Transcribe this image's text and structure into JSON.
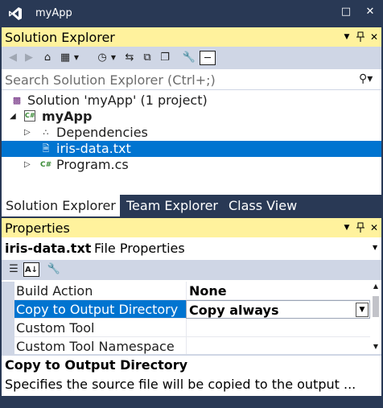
{
  "window": {
    "title": "myApp"
  },
  "colors": {
    "frame": "#293955",
    "active_header": "#fff29d",
    "toolbar": "#cfd6e5",
    "selection": "#0074d0"
  },
  "solution_explorer": {
    "header": "Solution Explorer",
    "search_placeholder": "Search Solution Explorer (Ctrl+;)",
    "tree": [
      {
        "label": "Solution 'myApp' (1 project)",
        "icon": "solution-icon",
        "expanded": null,
        "selected": false,
        "bold": false
      },
      {
        "label": "myApp",
        "icon": "csharp-project-icon",
        "expanded": true,
        "selected": false,
        "bold": true
      },
      {
        "label": "Dependencies",
        "icon": "dependencies-icon",
        "expanded": false,
        "selected": false,
        "bold": false
      },
      {
        "label": "iris-data.txt",
        "icon": "text-file-icon",
        "expanded": null,
        "selected": true,
        "bold": false
      },
      {
        "label": "Program.cs",
        "icon": "csharp-file-icon",
        "expanded": false,
        "selected": false,
        "bold": false
      }
    ],
    "tabs": [
      "Solution Explorer",
      "Team Explorer",
      "Class View"
    ],
    "active_tab": "Solution Explorer"
  },
  "properties": {
    "header": "Properties",
    "object_name": "iris-data.txt",
    "object_type": "File Properties",
    "rows": [
      {
        "name": "Build Action",
        "value": "None"
      },
      {
        "name": "Copy to Output Directory",
        "value": "Copy always"
      },
      {
        "name": "Custom Tool",
        "value": ""
      },
      {
        "name": "Custom Tool Namespace",
        "value": ""
      }
    ],
    "description_title": "Copy to Output Directory",
    "description_text": "Specifies the source file will be copied to the output ..."
  }
}
